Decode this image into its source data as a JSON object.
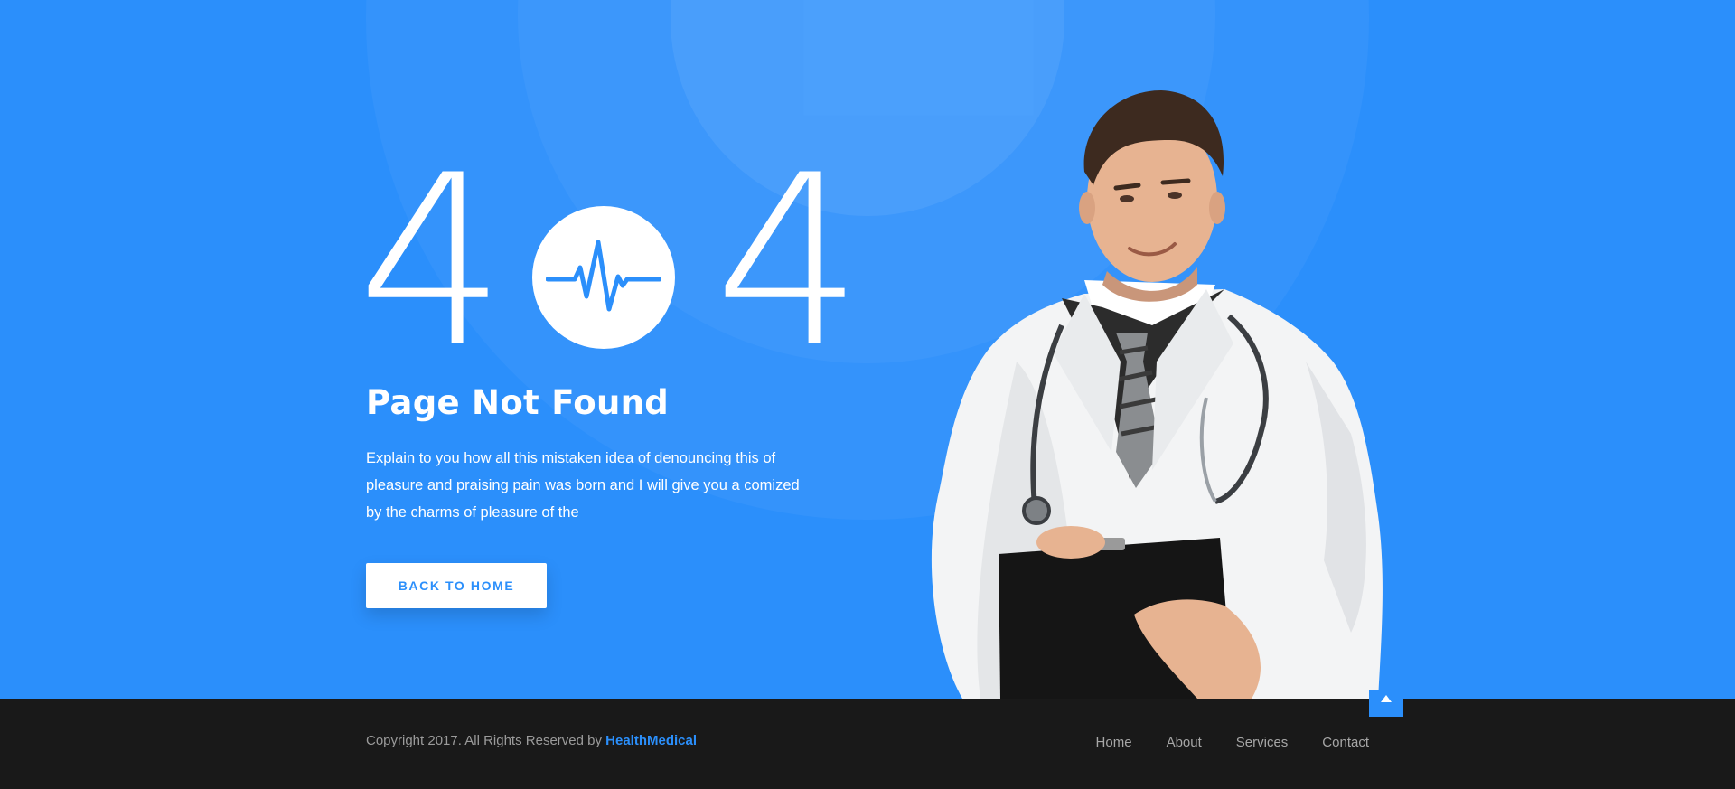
{
  "hero": {
    "digit_left": "4",
    "digit_right": "4",
    "center_icon": "heartbeat-icon",
    "title": "Page Not Found",
    "description": "Explain to you how all this mistaken idea of denouncing this of pleasure and praising pain was born and I will give you a comized by the charms of pleasure of the",
    "button_label": "BACK TO HOME",
    "image": "doctor-with-clipboard"
  },
  "footer": {
    "copyright_text": "Copyright 2017. All Rights Reserved by ",
    "brand": "HealthMedical",
    "nav": [
      {
        "label": "Home"
      },
      {
        "label": "About"
      },
      {
        "label": "Services"
      },
      {
        "label": "Contact"
      }
    ],
    "scroll_top_icon": "caret-up-icon"
  },
  "colors": {
    "primary": "#2b8ffb",
    "footer_bg": "#191919",
    "text_light": "#ffffff",
    "footer_text": "#9b9b9b"
  }
}
